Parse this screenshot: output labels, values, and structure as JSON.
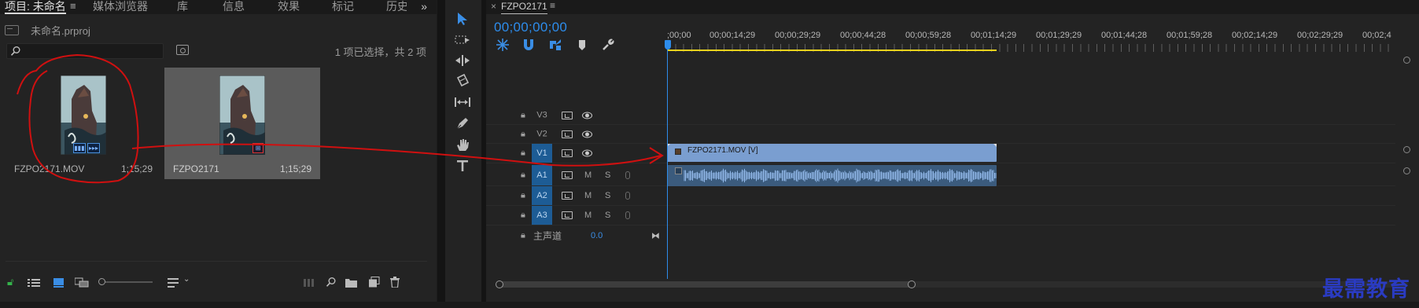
{
  "project_panel": {
    "tabs": [
      {
        "label": "项目: 未命名"
      },
      {
        "label": "媒体浏览器"
      },
      {
        "label": "库"
      },
      {
        "label": "信息"
      },
      {
        "label": "效果"
      },
      {
        "label": "标记"
      },
      {
        "label": "历史"
      }
    ],
    "tab_menu_glyph": "≡",
    "overflow_glyph": "»",
    "project_file": "未命名.prproj",
    "search_placeholder": "",
    "selection_status": "1 项已选择，共 2 项",
    "items": [
      {
        "name": "FZPO2171.MOV",
        "duration": "1;15;29",
        "selected": false
      },
      {
        "name": "FZPO2171",
        "duration": "1;15;29",
        "selected": true
      }
    ]
  },
  "timeline": {
    "sequence_name": "FZPO2171",
    "close_glyph": "×",
    "menu_glyph": "≡",
    "timecode": "00;00;00;00",
    "ruler_labels": [
      ";00;00",
      "00;00;14;29",
      "00;00;29;29",
      "00;00;44;28",
      "00;00;59;28",
      "00;01;14;29",
      "00;01;29;29",
      "00;01;44;28",
      "00;01;59;28",
      "00;02;14;29",
      "00;02;29;29",
      "00;02;4"
    ],
    "video_tracks": [
      "V3",
      "V2",
      "V1"
    ],
    "audio_tracks": [
      "A1",
      "A2",
      "A3"
    ],
    "mute_label": "M",
    "solo_label": "S",
    "master_label": "主声道",
    "master_value": "0.0",
    "video_clip_name": "FZPO2171.MOV [V]"
  },
  "watermark": "最需教育",
  "colors": {
    "accent_blue": "#2d8ceb",
    "work_area_yellow": "#e8d21d",
    "video_clip": "#7a9ed0",
    "audio_clip": "#3b5b7d",
    "annotation_red": "#d01010",
    "watermark_blue": "#2a3bc2"
  }
}
